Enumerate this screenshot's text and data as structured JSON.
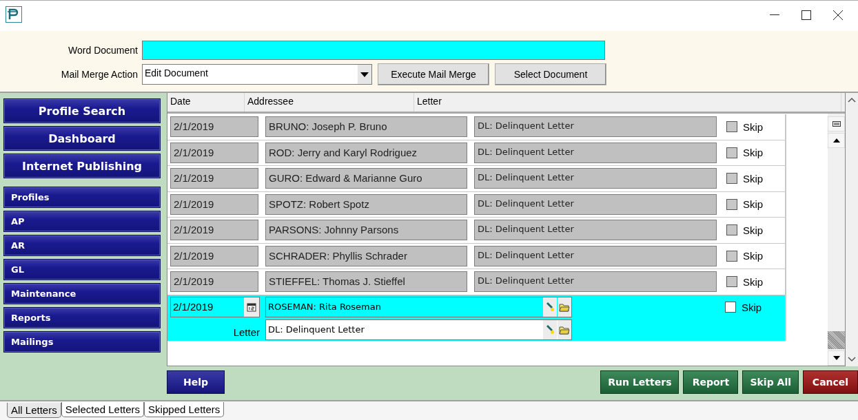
{
  "form": {
    "word_document": {
      "label": "Word Document"
    },
    "mail_merge_action": {
      "label": "Mail Merge Action",
      "value": "Edit Document"
    },
    "buttons": [
      "Execute Mail Merge",
      "Select Document"
    ]
  },
  "sidebar": {
    "large_items": [
      "Profile Search",
      "Dashboard",
      "Internet Publishing"
    ],
    "items": [
      "Profiles",
      "AP",
      "AR",
      "GL",
      "Maintenance",
      "Reports",
      "Mailings"
    ]
  },
  "table": {
    "columns": [
      "Date",
      "Addressee",
      "Letter"
    ],
    "rows": [
      {
        "date": "2/1/2019",
        "addressee": "BRUNO: Joseph P. Bruno",
        "letter": "DL: Delinquent Letter",
        "skip_label": "Skip",
        "skipped": false
      },
      {
        "date": "2/1/2019",
        "addressee": "ROD: Jerry and Karyl Rodriguez",
        "letter": "DL: Delinquent Letter",
        "skip_label": "Skip",
        "skipped": false
      },
      {
        "date": "2/1/2019",
        "addressee": "GURO: Edward & Marianne Guro",
        "letter": "DL: Delinquent Letter",
        "skip_label": "Skip",
        "skipped": false
      },
      {
        "date": "2/1/2019",
        "addressee": "SPOTZ: Robert Spotz",
        "letter": "DL: Delinquent Letter",
        "skip_label": "Skip",
        "skipped": false
      },
      {
        "date": "2/1/2019",
        "addressee": "PARSONS: Johnny Parsons",
        "letter": "DL: Delinquent Letter",
        "skip_label": "Skip",
        "skipped": false
      },
      {
        "date": "2/1/2019",
        "addressee": "SCHRADER: Phyllis Schrader",
        "letter": "DL: Delinquent Letter",
        "skip_label": "Skip",
        "skipped": false
      },
      {
        "date": "2/1/2019",
        "addressee": "STIEFFEL: Thomas J. Stieffel",
        "letter": "DL: Delinquent Letter",
        "skip_label": "Skip",
        "skipped": false
      }
    ],
    "edit_row": {
      "date": "2/1/2019",
      "addressee": "ROSEMAN: Rita Roseman",
      "letter_label": "Letter",
      "letter": "DL: Delinquent Letter",
      "skip_label": "Skip",
      "skipped": false
    }
  },
  "footer_buttons": [
    {
      "label": "Help",
      "kind": "help"
    },
    {
      "label": "Run Letters",
      "kind": "action"
    },
    {
      "label": "Report",
      "kind": "action"
    },
    {
      "label": "Skip All",
      "kind": "action"
    },
    {
      "label": "Cancel",
      "kind": "cancel"
    }
  ],
  "tabs": [
    {
      "label": "All Letters",
      "selected": true
    },
    {
      "label": "Selected Letters",
      "selected": false
    },
    {
      "label": "Skipped Letters",
      "selected": false
    }
  ]
}
